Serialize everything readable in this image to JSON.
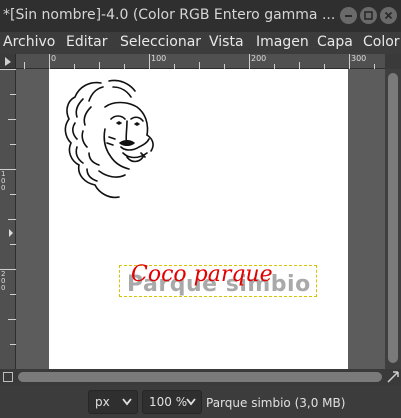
{
  "window": {
    "title": "*[Sin nombre]-4.0 (Color RGB Entero gamma ..."
  },
  "menu": [
    "Archivo",
    "Editar",
    "Seleccionar",
    "Vista",
    "Imagen",
    "Capa",
    "Color"
  ],
  "ruler": {
    "h_labels": [
      "0",
      "100",
      "200",
      "300"
    ],
    "v_labels": [
      "1\n0\n0",
      "2\n0\n0"
    ]
  },
  "canvas": {
    "text_red": "Coco parque",
    "text_grey": "Parque simbio"
  },
  "status": {
    "unit": "px",
    "zoom": "100 %",
    "layer_info": "Parque simbio (3,0 MB)"
  },
  "colors": {
    "text_red": "#e30000",
    "layer_boundary": "#d8c400",
    "canvas_bg": "#ffffff",
    "workspace_bg": "#5c5c5c"
  }
}
